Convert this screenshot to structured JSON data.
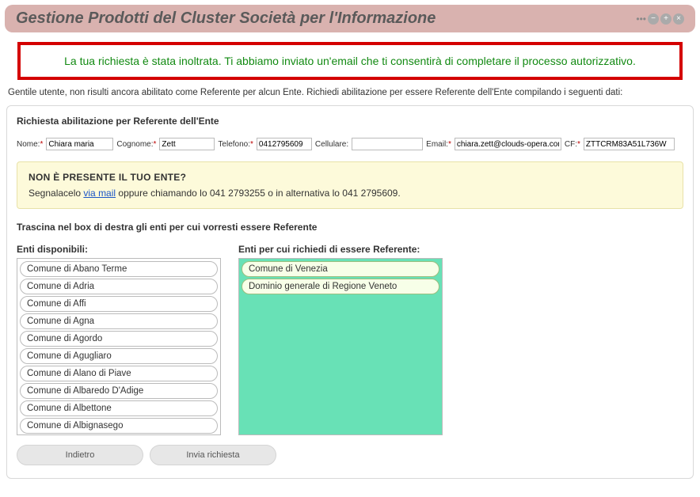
{
  "header": {
    "title": "Gestione Prodotti del Cluster Società per l'Informazione"
  },
  "success_message": "La tua richiesta è stata inoltrata. Ti abbiamo inviato un'email che ti consentirà di completare il processo autorizzativo.",
  "intro": "Gentile utente, non risulti ancora abilitato come Referente per alcun Ente. Richiedi abilitazione per essere Referente dell'Ente compilando i seguenti dati:",
  "panel": {
    "title": "Richiesta abilitazione per Referente dell'Ente",
    "fields": {
      "nome_label": "Nome:",
      "nome_value": "Chiara maria",
      "cognome_label": "Cognome:",
      "cognome_value": "Zett",
      "telefono_label": "Telefono:",
      "telefono_value": "0412795609",
      "cellulare_label": "Cellulare:",
      "cellulare_value": "",
      "email_label": "Email:",
      "email_value": "chiara.zett@clouds-opera.com",
      "cf_label": "CF:",
      "cf_value": "ZTTCRM83A51L736W"
    },
    "note": {
      "title": "NON È PRESENTE IL TUO ENTE?",
      "prefix": "Segnalacelo ",
      "link_text": "via mail",
      "suffix": " oppure chiamando lo 041 2793255 o in alternativa lo 041 2795609."
    },
    "drag_instruction": "Trascina nel box di destra gli enti per cui vorresti essere Referente",
    "left_label": "Enti disponibili:",
    "right_label": "Enti per cui richiedi di essere Referente:",
    "available": [
      "Comune di Abano Terme",
      "Comune di Adria",
      "Comune di Affi",
      "Comune di Agna",
      "Comune di Agordo",
      "Comune di Agugliaro",
      "Comune di Alano di Piave",
      "Comune di Albaredo D'Adige",
      "Comune di Albettone",
      "Comune di Albignasego"
    ],
    "selected": [
      "Comune di Venezia",
      "Dominio generale di Regione Veneto"
    ],
    "buttons": {
      "back": "Indietro",
      "submit": "Invia richiesta"
    }
  }
}
